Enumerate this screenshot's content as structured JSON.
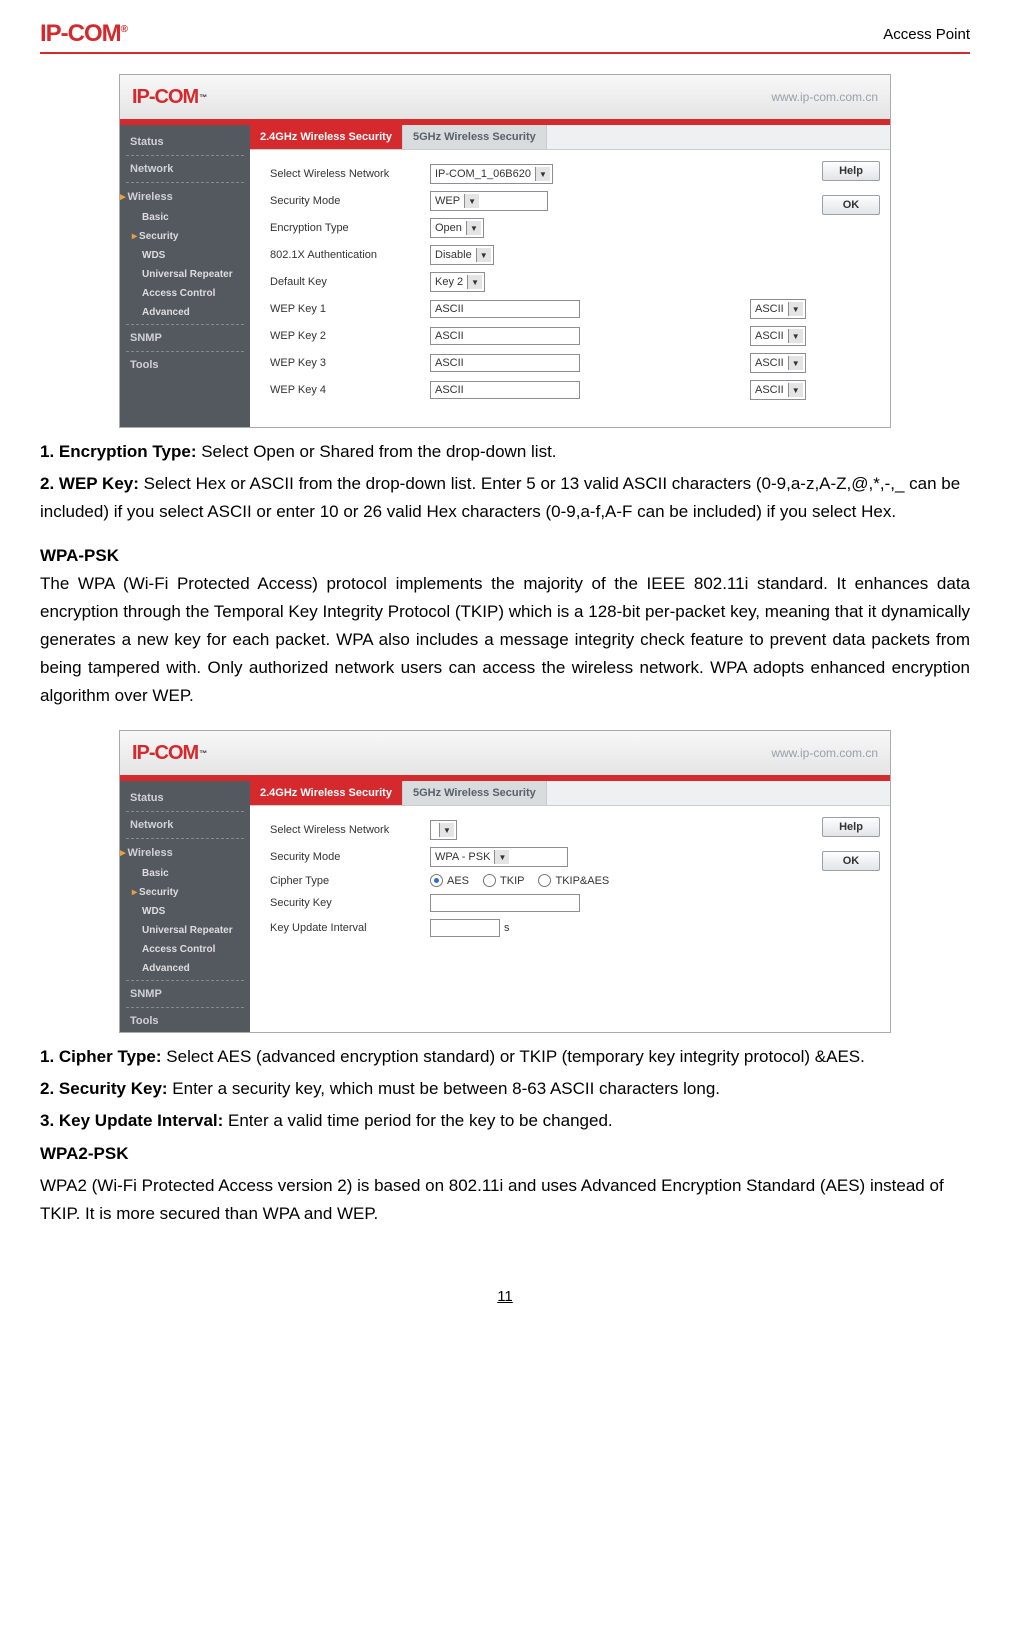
{
  "brand": {
    "logo_text": "IP-COM",
    "logo_reg": "®",
    "logo_small_tm": "™"
  },
  "header": {
    "right_text": "Access Point"
  },
  "page_number": "11",
  "ui": {
    "url": "www.ip-com.com.cn",
    "nav": {
      "status": "Status",
      "network": "Network",
      "wireless": "Wireless",
      "basic": "Basic",
      "security": "Security",
      "wds": "WDS",
      "universal_repeater": "Universal Repeater",
      "access_control": "Access Control",
      "advanced": "Advanced",
      "snmp": "SNMP",
      "tools": "Tools"
    },
    "tabs": {
      "t24": "2.4GHz Wireless Security",
      "t5": "5GHz Wireless Security"
    },
    "buttons": {
      "help": "Help",
      "ok": "OK"
    },
    "wep": {
      "lbl_select_network": "Select Wireless Network",
      "val_network": "IP-COM_1_06B620",
      "lbl_sec_mode": "Security Mode",
      "val_sec_mode": "WEP",
      "lbl_enc_type": "Encryption Type",
      "val_enc_type": "Open",
      "lbl_8021x": "802.1X Authentication",
      "val_8021x": "Disable",
      "lbl_def_key": "Default Key",
      "val_def_key": "Key 2",
      "lbl_key1": "WEP Key 1",
      "lbl_key2": "WEP Key 2",
      "lbl_key3": "WEP Key 3",
      "lbl_key4": "WEP Key 4",
      "val_ascii": "ASCII"
    },
    "wpa": {
      "lbl_select_network": "Select Wireless Network",
      "val_network": "",
      "lbl_sec_mode": "Security Mode",
      "val_sec_mode": "WPA - PSK",
      "lbl_cipher": "Cipher Type",
      "cipher_aes": "AES",
      "cipher_tkip": "TKIP",
      "cipher_both": "TKIP&AES",
      "lbl_sec_key": "Security Key",
      "lbl_key_interval": "Key Update Interval",
      "interval_unit": "s"
    }
  },
  "text": {
    "wep_1_label": "1. Encryption Type:",
    "wep_1_body": " Select Open or Shared from the drop-down list.",
    "wep_2_label": "2. WEP Key:",
    "wep_2_body": " Select Hex or ASCII from the drop-down list. Enter 5 or 13 valid ASCII characters (0-9,a-z,A-Z,@,*,-,_ can be included) if you select ASCII or enter 10 or 26 valid Hex characters (0-9,a-f,A-F can be included) if you select Hex.",
    "wpa_heading": "WPA-PSK",
    "wpa_body": "The WPA (Wi-Fi Protected Access) protocol implements the majority of the IEEE 802.11i standard. It enhances data encryption through the Temporal Key Integrity Protocol (TKIP) which is a 128-bit per-packet key, meaning that it dynamically generates a new key for each packet. WPA also includes a message integrity check feature to prevent data packets from being tampered with. Only authorized network users can access the wireless network. WPA adopts enhanced encryption algorithm over WEP.",
    "wpa_1_label": "1. Cipher Type:",
    "wpa_1_body": " Select AES (advanced encryption standard) or TKIP (temporary key integrity protocol) &AES.",
    "wpa_2_label": "2. Security Key:",
    "wpa_2_body": " Enter a security key, which must be between 8-63 ASCII characters long.",
    "wpa_3_label": "3. Key Update Interval:",
    "wpa_3_body": " Enter a valid time period for the key to be changed.",
    "wpa2_heading": "WPA2-PSK",
    "wpa2_body": "WPA2 (Wi-Fi Protected Access version 2) is based on 802.11i and uses Advanced Encryption Standard (AES) instead of TKIP. It is more secured than WPA and WEP."
  }
}
